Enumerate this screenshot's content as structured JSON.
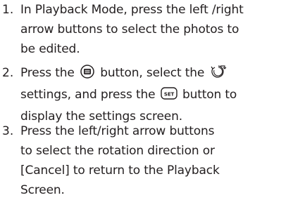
{
  "page": {
    "top_fragment": "",
    "steps": [
      {
        "number": "1.",
        "lines": [
          "In Playback Mode, press the left /right",
          "arrow buttons to select the photos to",
          "be edited."
        ]
      },
      {
        "number": "2.",
        "line1_before_menu": "Press the",
        "line1_after_menu": "button, select the",
        "line2_before_set": "settings, and press the",
        "line2_after_set": "button to",
        "line3": "display the settings screen.",
        "set_icon_label": "SET",
        "menu_icon": "menu-button-icon",
        "rotate_icon": "rotate-icon"
      },
      {
        "number": "3.",
        "lines": [
          "Press the left/right arrow buttons",
          "to select the rotation direction or",
          "[Cancel] to return to the Playback",
          "Screen."
        ]
      }
    ]
  }
}
